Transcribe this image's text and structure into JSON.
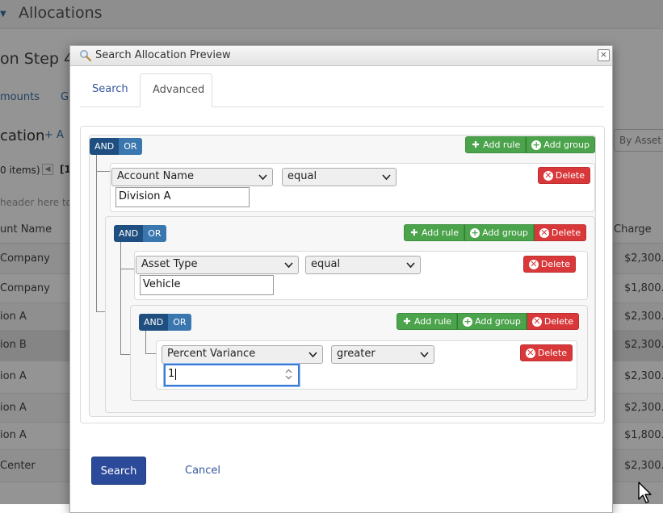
{
  "background": {
    "app_title": "Allocations",
    "step_heading": "on  Step 4",
    "tabs": [
      "mounts",
      "G"
    ],
    "section": "cation",
    "add_label": "+ A",
    "by_asset": "By Asset",
    "items_count": "0 items)",
    "pager_current": "[1",
    "group_hint": "header here to",
    "columns": {
      "first": "unt Name",
      "last": "Charge"
    },
    "rows": [
      {
        "name": "Company",
        "charge": "$2,300.0"
      },
      {
        "name": "Company",
        "charge": "$1,800.0"
      },
      {
        "name": "ion A",
        "charge": "$2,300.0"
      },
      {
        "name": "ion B",
        "charge": "$2,300.0"
      },
      {
        "name": "ion A",
        "charge": "$2,300.0"
      },
      {
        "name": "ion A",
        "charge": "$2,300.0"
      },
      {
        "name": "ion A",
        "charge": "$1,800.0"
      },
      {
        "name": "Center",
        "charge": "$2,300.0"
      }
    ]
  },
  "dialog": {
    "title": "Search Allocation Preview",
    "close_glyph": "×",
    "tabs": {
      "search": "Search",
      "advanced": "Advanced"
    },
    "labels": {
      "and": "AND",
      "or": "OR",
      "add_rule": "Add rule",
      "add_group": "Add group",
      "delete": "Delete"
    },
    "rules": {
      "r1": {
        "field": "Account Name",
        "operator": "equal",
        "value": "Division A"
      },
      "r2": {
        "field": "Asset Type",
        "operator": "equal",
        "value": "Vehicle"
      },
      "r3": {
        "field": "Percent Variance",
        "operator": "greater",
        "value": "1"
      }
    },
    "footer": {
      "search": "Search",
      "cancel": "Cancel"
    }
  }
}
